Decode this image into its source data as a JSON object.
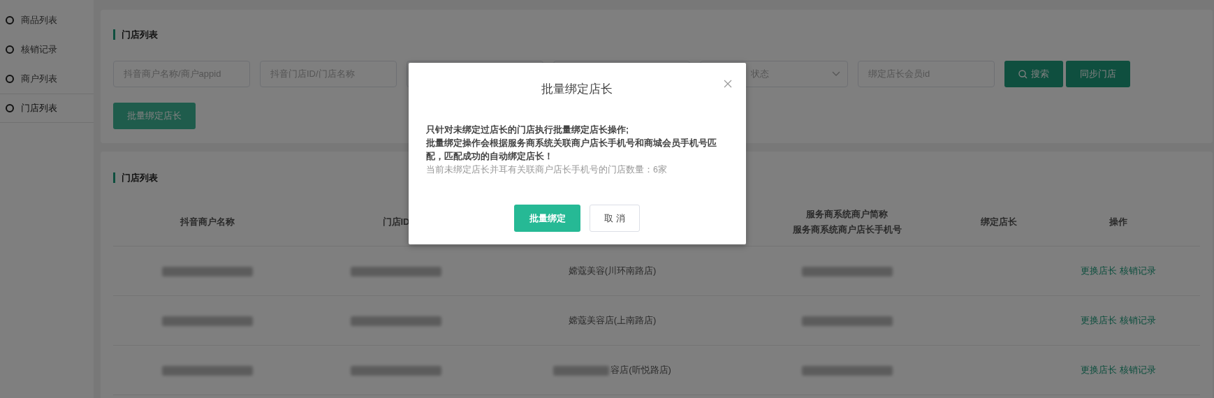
{
  "sidebar": {
    "items": [
      {
        "label": "商品列表",
        "selected": false
      },
      {
        "label": "核销记录",
        "selected": false
      },
      {
        "label": "商户列表",
        "selected": false
      },
      {
        "label": "门店列表",
        "selected": true
      }
    ]
  },
  "filter_panel": {
    "title": "门店列表",
    "fields": [
      {
        "kind": "input",
        "placeholder": "抖音商户名称/商户appid"
      },
      {
        "kind": "input",
        "placeholder": "抖音门店ID/门店名称"
      },
      {
        "kind": "input"
      },
      {
        "kind": "input"
      },
      {
        "kind": "select",
        "placeholder": "状态"
      },
      {
        "kind": "input",
        "placeholder": "绑定店长会员id"
      }
    ],
    "search_button": "搜索",
    "sync_button": "同步门店",
    "bulk_bind_button": "批量绑定店长"
  },
  "store_table": {
    "title": "门店列表",
    "columns": [
      {
        "label": "抖音商户名称"
      },
      {
        "label": "门店ID"
      },
      {},
      {
        "lines": [
          "服务商系统商户简称",
          "服务商系统商户店长手机号"
        ]
      },
      {
        "label": "绑定店长"
      },
      {
        "label": "操作"
      }
    ],
    "rows": [
      {
        "store_name": "嫦蔻美容(川环南路店)",
        "name_partly_blurred": false,
        "actions": [
          "更换店长",
          "核销记录"
        ]
      },
      {
        "store_name": "嫦蔻美容店(上南路店)",
        "name_partly_blurred": false,
        "actions": [
          "更换店长",
          "核销记录"
        ]
      },
      {
        "store_name": "容店(听悦路店)",
        "name_partly_blurred": true,
        "actions": [
          "更换店长",
          "核销记录"
        ]
      }
    ]
  },
  "modal": {
    "title": "批量绑定店长",
    "notes": [
      "只针对未绑定过店长的门店执行批量绑定店长操作;",
      "批量绑定操作会根据服务商系统关联商户店长手机号和商城会员手机号匹配，匹配成功的自动绑定店长！"
    ],
    "count_line": "当前未绑定店长并耳有关联商户店长手机号的门店数量：6家",
    "confirm_button": "批量绑定",
    "cancel_button": "取 消"
  }
}
